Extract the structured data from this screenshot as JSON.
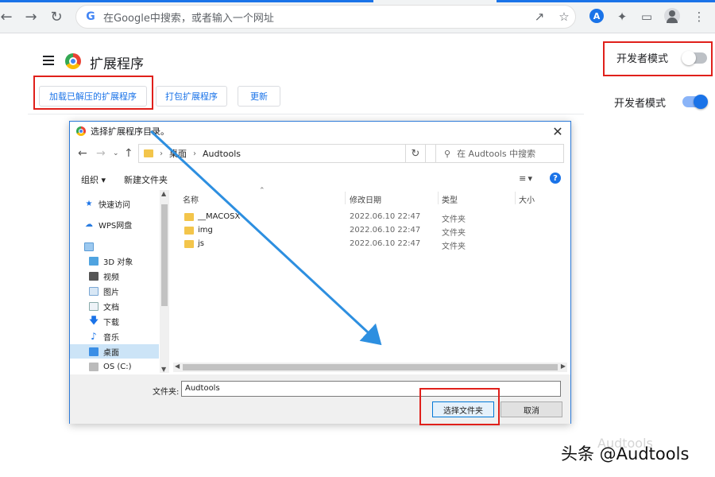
{
  "browser": {
    "omnibox": {
      "placeholder": "在Google中搜索，或者输入一个网址",
      "engine_icon": "G"
    },
    "profile_badge": "A",
    "icons": [
      "back-icon",
      "forward-icon",
      "reload-icon",
      "share-icon",
      "star-icon",
      "puzzle-icon",
      "side-panel-icon",
      "profile-icon",
      "more-icon"
    ],
    "accent_color": "#1a73e8"
  },
  "page": {
    "title": "扩展程序",
    "buttons": {
      "load_unpacked": "加载已解压的扩展程序",
      "pack": "打包扩展程序",
      "update": "更新"
    },
    "dev_mode_off_label": "开发者模式",
    "dev_mode_on_label": "开发者模式",
    "dev_mode_off": false,
    "dev_mode_on": true
  },
  "dialog": {
    "title": "选择扩展程序目录。",
    "path": [
      "桌面",
      "Audtools"
    ],
    "search_placeholder": "在 Audtools 中搜索",
    "toolbar": {
      "organize": "组织 ▾",
      "new_folder": "新建文件夹"
    },
    "nav_items": [
      {
        "label": "快速访问",
        "icon": "star-icon"
      },
      {
        "label": "WPS网盘",
        "icon": "cloud-icon"
      },
      {
        "label": "",
        "icon": "computer-icon"
      },
      {
        "label": "3D 对象",
        "icon": "cube-icon"
      },
      {
        "label": "视频",
        "icon": "video-icon"
      },
      {
        "label": "图片",
        "icon": "image-icon"
      },
      {
        "label": "文档",
        "icon": "document-icon"
      },
      {
        "label": "下载",
        "icon": "download-icon"
      },
      {
        "label": "音乐",
        "icon": "music-icon"
      },
      {
        "label": "桌面",
        "icon": "desktop-icon"
      },
      {
        "label": "OS (C:)",
        "icon": "drive-icon"
      }
    ],
    "columns": [
      "名称",
      "修改日期",
      "类型",
      "大小"
    ],
    "files": [
      {
        "name": "__MACOSX",
        "date": "2022.06.10 22:47",
        "type": "文件夹"
      },
      {
        "name": "img",
        "date": "2022.06.10 22:47",
        "type": "文件夹"
      },
      {
        "name": "js",
        "date": "2022.06.10 22:47",
        "type": "文件夹"
      }
    ],
    "folder_label": "文件夹:",
    "folder_value": "Audtools",
    "select_button": "选择文件夹",
    "cancel_button": "取消"
  },
  "watermark": {
    "text": "头条 @Audtools",
    "ghost": "Audtools"
  },
  "annotation_color": "#e0201b",
  "arrow_color": "#2d8fe0"
}
